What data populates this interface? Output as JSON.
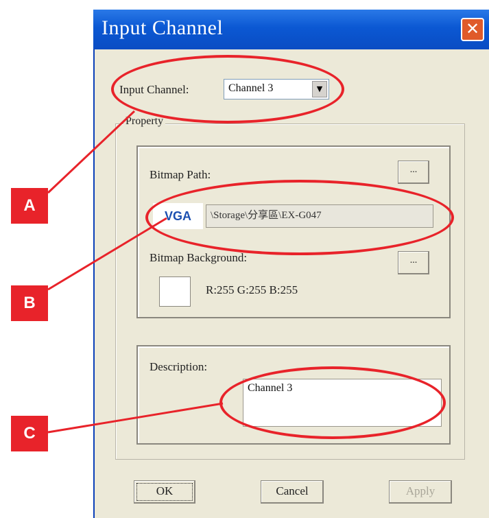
{
  "window": {
    "title": "Input Channel",
    "close_glyph": "✕"
  },
  "input_channel": {
    "label": "Input Channel:",
    "selected": "Channel 3",
    "arrow_glyph": "▼"
  },
  "property": {
    "group_label": "Property",
    "bitmap_path": {
      "label": "Bitmap Path:",
      "browse_label": "...",
      "badge": "VGA",
      "value": "\\Storage\\分享區\\EX-G047"
    },
    "bitmap_background": {
      "label": "Bitmap Background:",
      "browse_label": "...",
      "swatch_color": "#ffffff",
      "rgb_text": "R:255  G:255  B:255"
    }
  },
  "description": {
    "label": "Description:",
    "value": "Channel 3"
  },
  "buttons": {
    "ok": "OK",
    "cancel": "Cancel",
    "apply": "Apply"
  },
  "annotations": {
    "color": "#e8232a",
    "markers": [
      "A",
      "B",
      "C"
    ]
  }
}
